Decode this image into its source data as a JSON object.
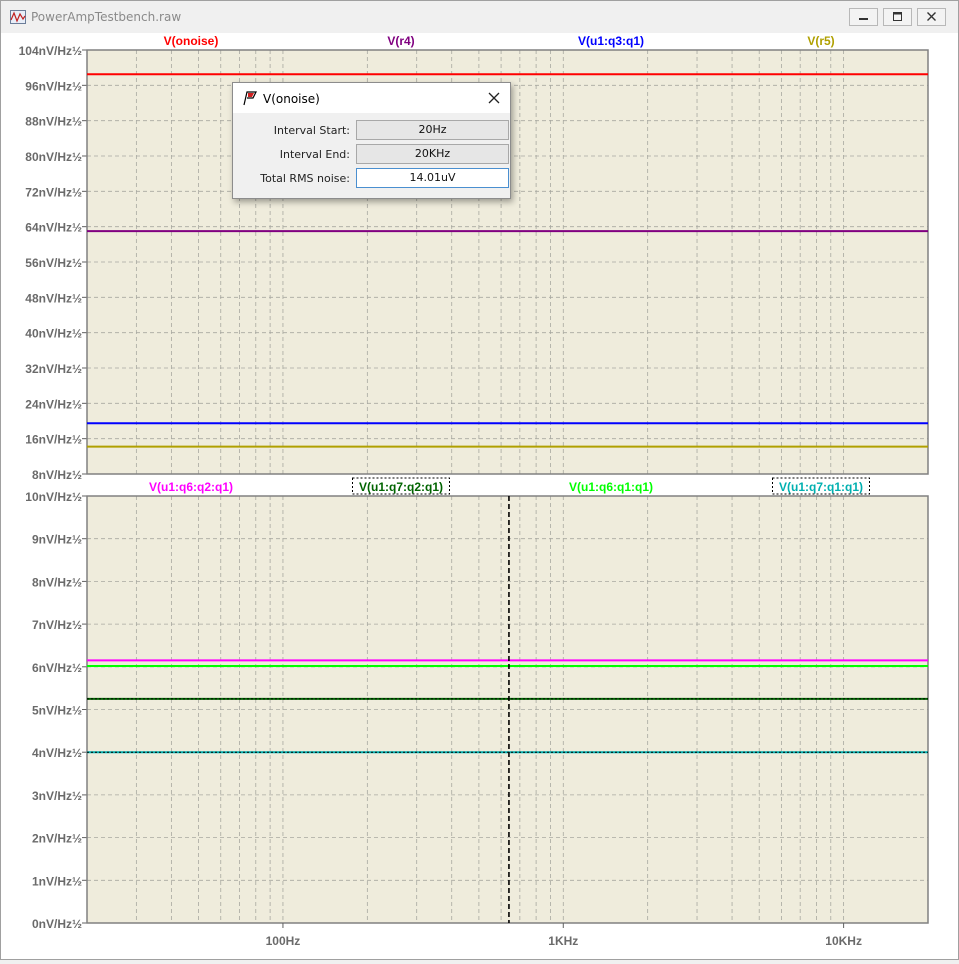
{
  "window": {
    "title": "PowerAmpTestbench.raw"
  },
  "top_pane": {
    "traces": [
      {
        "label": "V(onoise)",
        "color": "#ff0000",
        "value": 98.5
      },
      {
        "label": "V(r4)",
        "color": "#800080",
        "value": 63.0
      },
      {
        "label": "V(u1:q3:q1)",
        "color": "#0000ff",
        "value": 19.5
      },
      {
        "label": "V(r5)",
        "color": "#b0a000",
        "value": 14.2
      }
    ],
    "y_ticks": [
      "104nV/Hz½",
      "96nV/Hz½",
      "88nV/Hz½",
      "80nV/Hz½",
      "72nV/Hz½",
      "64nV/Hz½",
      "56nV/Hz½",
      "48nV/Hz½",
      "40nV/Hz½",
      "32nV/Hz½",
      "24nV/Hz½",
      "16nV/Hz½",
      "8nV/Hz½"
    ]
  },
  "bottom_pane": {
    "traces": [
      {
        "label": "V(u1:q6:q2:q1)",
        "color": "#ff00ff",
        "value": 6.15
      },
      {
        "label": "V(u1:q7:q2:q1)",
        "color": "#006400",
        "value": 5.25
      },
      {
        "label": "V(u1:q6:q1:q1)",
        "color": "#00ff00",
        "value": 6.02
      },
      {
        "label": "V(u1:q7:q1:q1)",
        "color": "#00b0b0",
        "value": 4.0
      }
    ],
    "y_ticks": [
      "10nV/Hz½",
      "9nV/Hz½",
      "8nV/Hz½",
      "7nV/Hz½",
      "6nV/Hz½",
      "5nV/Hz½",
      "4nV/Hz½",
      "3nV/Hz½",
      "2nV/Hz½",
      "1nV/Hz½",
      "0nV/Hz½"
    ]
  },
  "x_axis": {
    "tick_labels": [
      "100Hz",
      "1KHz",
      "10KHz"
    ],
    "cursor_freq": 640
  },
  "dialog": {
    "title": "V(onoise)",
    "rows": [
      {
        "label": "Interval Start:",
        "value": "20Hz"
      },
      {
        "label": "Interval End:",
        "value": "20KHz"
      },
      {
        "label": "Total RMS noise:",
        "value": "14.01uV"
      }
    ]
  },
  "chart_data": [
    {
      "type": "line",
      "x_scale": "log",
      "xlim": [
        20,
        20000
      ],
      "ylim": [
        8,
        104
      ],
      "y_unit": "nV/Hz½",
      "series": [
        {
          "name": "V(onoise)",
          "x": [
            20,
            20000
          ],
          "y": [
            98.5,
            98.5
          ]
        },
        {
          "name": "V(r4)",
          "x": [
            20,
            20000
          ],
          "y": [
            63.0,
            63.0
          ]
        },
        {
          "name": "V(u1:q3:q1)",
          "x": [
            20,
            20000
          ],
          "y": [
            19.5,
            19.5
          ]
        },
        {
          "name": "V(r5)",
          "x": [
            20,
            20000
          ],
          "y": [
            14.2,
            14.2
          ]
        }
      ]
    },
    {
      "type": "line",
      "x_scale": "log",
      "xlim": [
        20,
        20000
      ],
      "ylim": [
        0,
        10
      ],
      "y_unit": "nV/Hz½",
      "x_tick_labels": [
        "100Hz",
        "1KHz",
        "10KHz"
      ],
      "series": [
        {
          "name": "V(u1:q6:q2:q1)",
          "x": [
            20,
            20000
          ],
          "y": [
            6.15,
            6.15
          ]
        },
        {
          "name": "V(u1:q7:q2:q1)",
          "x": [
            20,
            20000
          ],
          "y": [
            5.25,
            5.25
          ]
        },
        {
          "name": "V(u1:q6:q1:q1)",
          "x": [
            20,
            20000
          ],
          "y": [
            6.02,
            6.02
          ]
        },
        {
          "name": "V(u1:q7:q1:q1)",
          "x": [
            20,
            20000
          ],
          "y": [
            4.0,
            4.0
          ]
        }
      ]
    }
  ]
}
